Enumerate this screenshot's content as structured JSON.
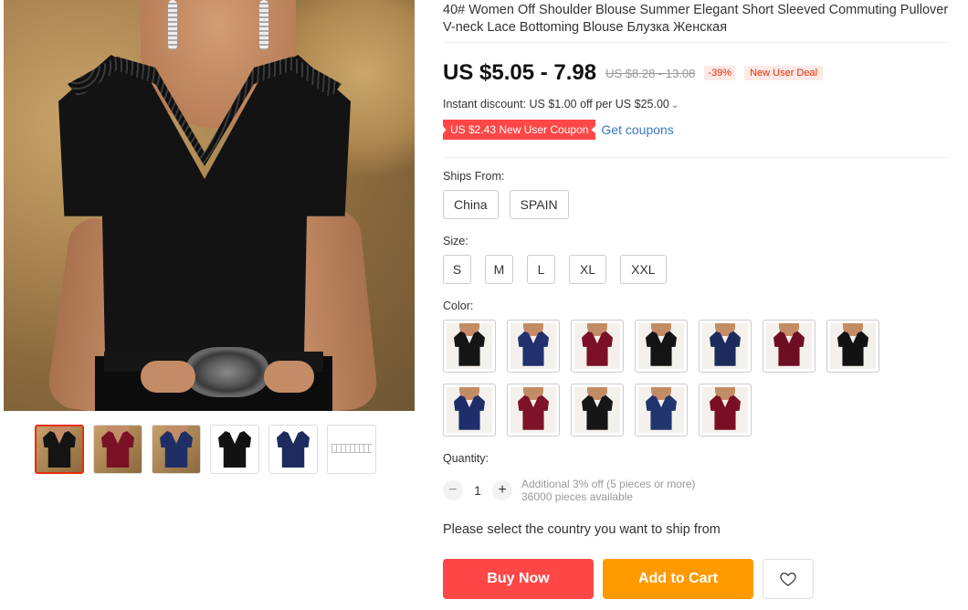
{
  "product": {
    "title": "40# Women Off Shoulder Blouse Summer Elegant Short Sleeved Commuting Pullover V-neck Lace Bottoming Blouse Блузка Женская",
    "price": "US $5.05 - 7.98",
    "old_price": "US $8.28 - 13.08",
    "discount_pct": "-39%",
    "deal_badge": "New User Deal",
    "instant_discount": "Instant discount: US $1.00 off per US $25.00",
    "coupon": "US $2.43 New User Coupon",
    "get_coupons": "Get coupons"
  },
  "thumbnails": [
    {
      "name": "black-lace",
      "color": "#141414",
      "active": true
    },
    {
      "name": "wine-lace",
      "color": "#7a1126",
      "active": false
    },
    {
      "name": "navy-lace",
      "color": "#1f2f66",
      "active": false
    },
    {
      "name": "black-flat",
      "color": "#121212",
      "active": false
    },
    {
      "name": "navy-flat",
      "color": "#1d2b5e",
      "active": false
    },
    {
      "name": "size-chart",
      "color": "#cccccc",
      "active": false
    }
  ],
  "ships_from": {
    "label": "Ships From:",
    "options": [
      "China",
      "SPAIN"
    ]
  },
  "size": {
    "label": "Size:",
    "options": [
      "S",
      "M",
      "L",
      "XL",
      "XXL"
    ]
  },
  "color": {
    "label": "Color:",
    "swatches": [
      "#151515",
      "#23306e",
      "#7b1027",
      "#141414",
      "#1d2a5c",
      "#6e0e22",
      "#121212",
      "#1f2d6a",
      "#7e1226",
      "#161616",
      "#22346e",
      "#7a0f24"
    ]
  },
  "quantity": {
    "label": "Quantity:",
    "value": "1",
    "minus": "−",
    "plus": "+",
    "bulk_note": "Additional 3% off (5 pieces or more)",
    "available": "36000 pieces available"
  },
  "ship_message": "Please select the country you want to ship from",
  "actions": {
    "buy_now": "Buy Now",
    "add_to_cart": "Add to Cart"
  }
}
